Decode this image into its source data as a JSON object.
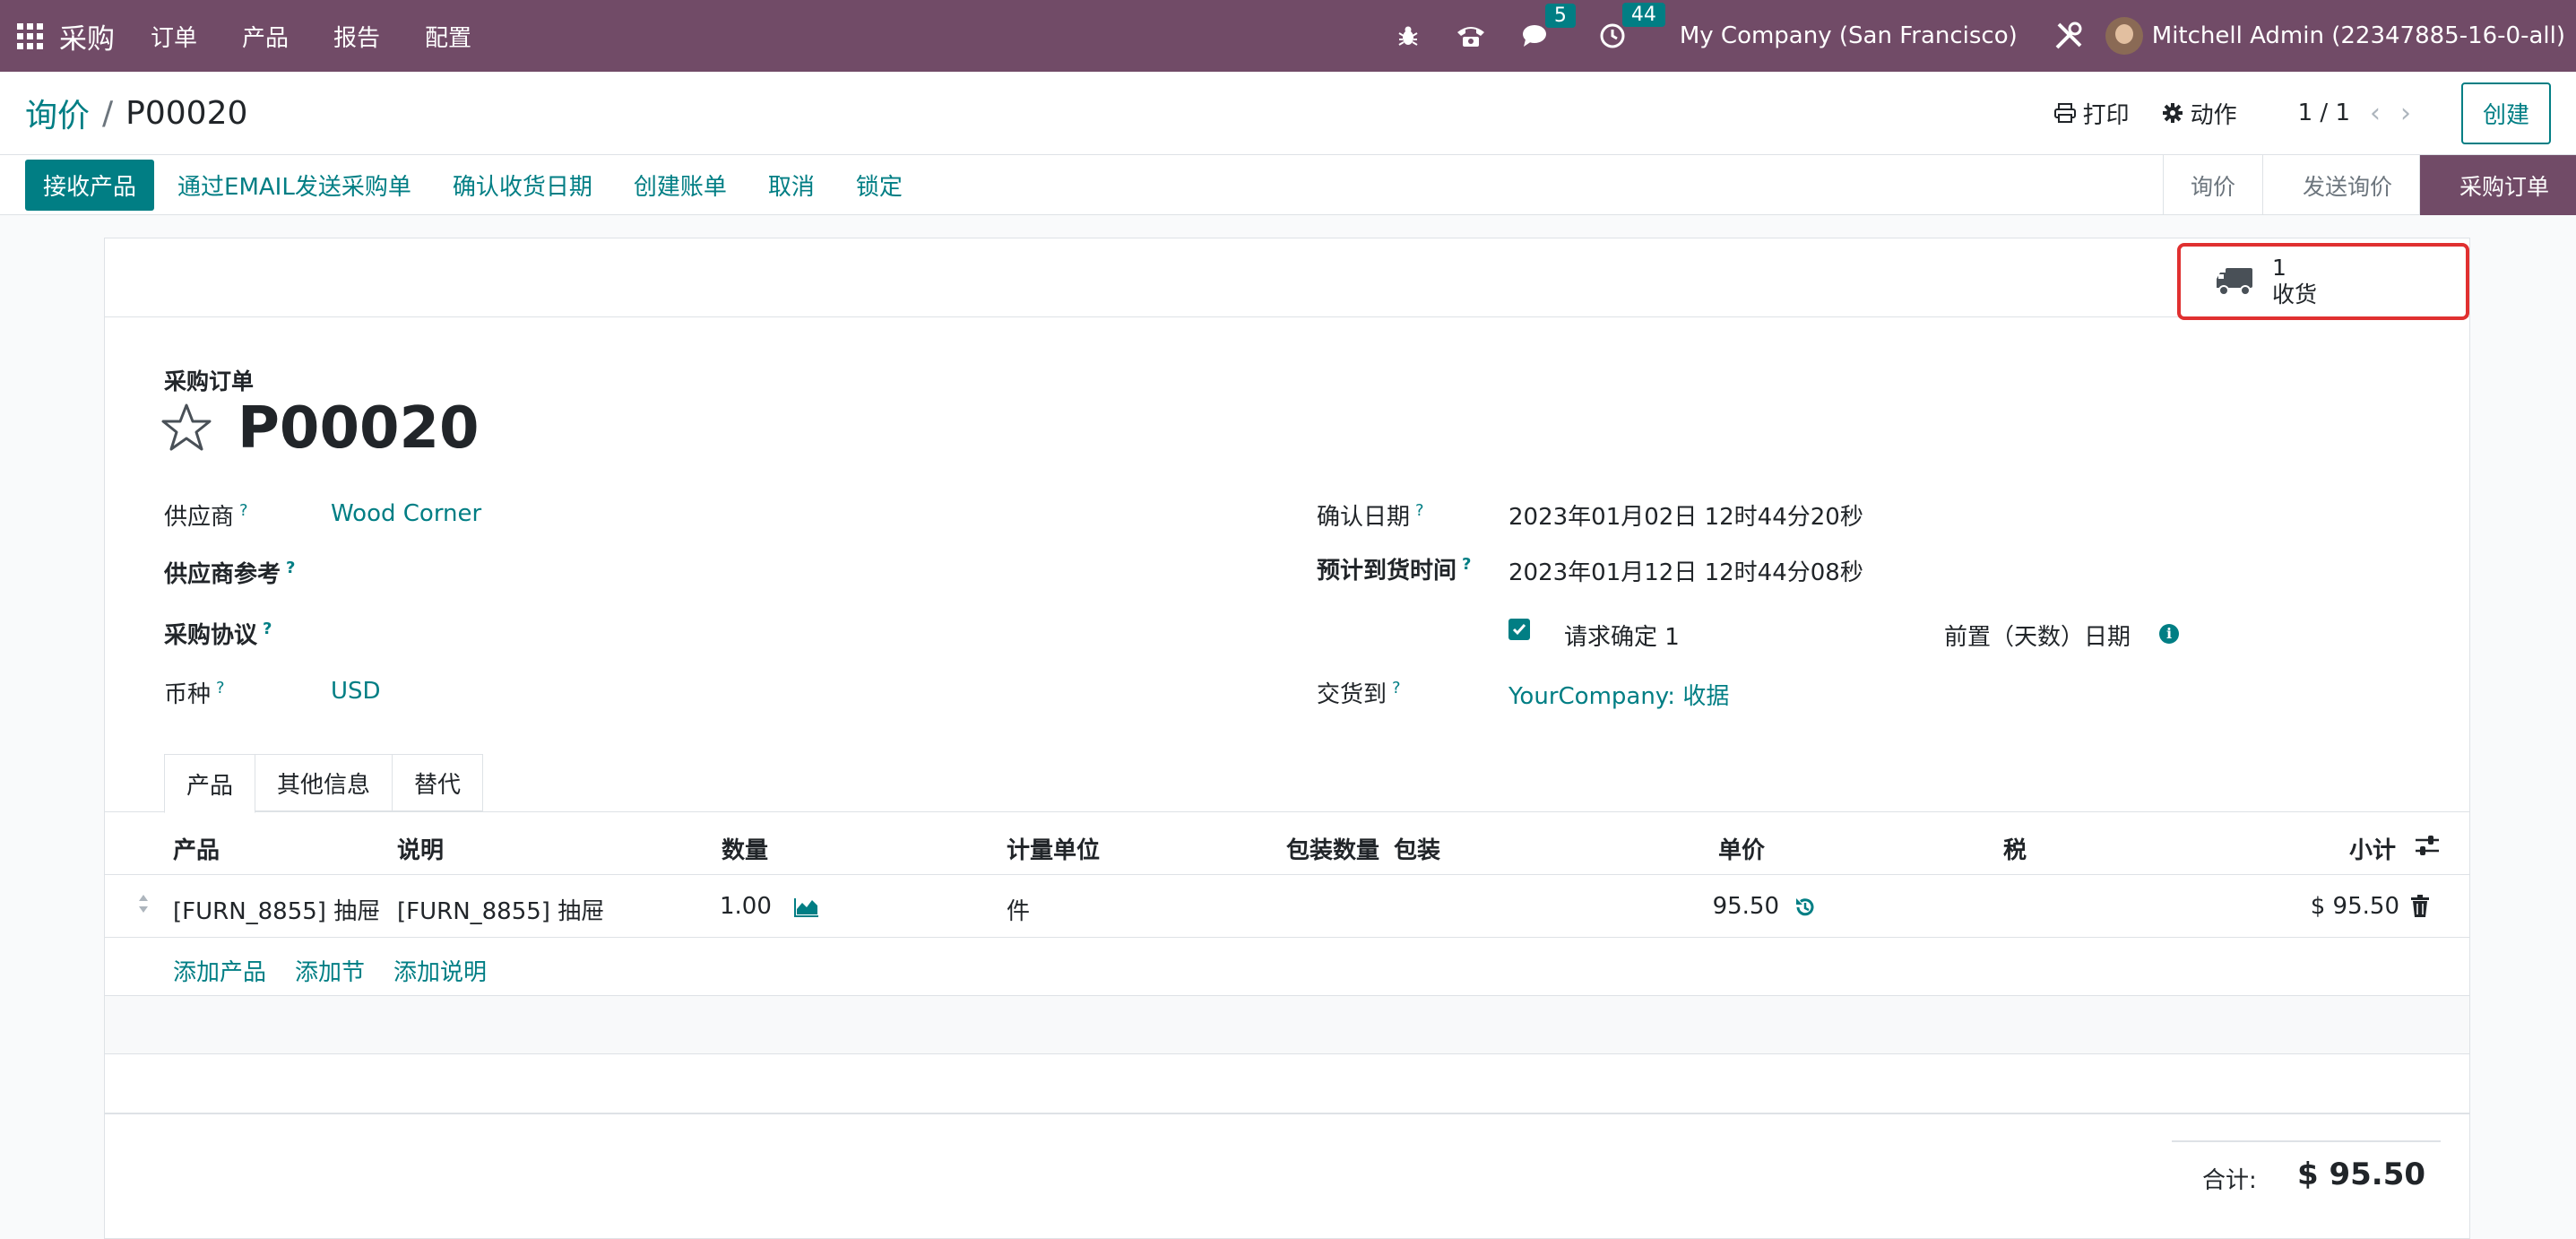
{
  "navbar": {
    "app_name": "采购",
    "menus": [
      "订单",
      "产品",
      "报告",
      "配置"
    ],
    "messages_count": "5",
    "activities_count": "44",
    "company": "My Company (San Francisco)",
    "user": "Mitchell Admin (22347885-16-0-all)"
  },
  "breadcrumb": {
    "parent": "询价",
    "separator": "/",
    "current": "P00020"
  },
  "control": {
    "print_label": "打印",
    "action_label": "动作",
    "pager": "1 / 1",
    "create_label": "创建"
  },
  "statusbar": {
    "buttons": [
      "接收产品",
      "通过EMAIL发送采购单",
      "确认收货日期",
      "创建账单",
      "取消",
      "锁定"
    ],
    "stages": [
      "询价",
      "发送询价",
      "采购订单"
    ],
    "active_stage": "采购订单"
  },
  "smart_button": {
    "count": "1",
    "label": "收货"
  },
  "form": {
    "title_label": "采购订单",
    "title": "P00020",
    "vendor_label": "供应商",
    "vendor": "Wood Corner",
    "vendor_ref_label": "供应商参考",
    "agreement_label": "采购协议",
    "currency_label": "币种",
    "currency": "USD",
    "confirm_date_label": "确认日期",
    "confirm_date": "2023年01月02日 12时44分20秒",
    "expected_arrival_label": "预计到货时间",
    "expected_arrival": "2023年01月12日 12时44分08秒",
    "ask_confirm": "请求确定 1",
    "lead_days_label": "前置（天数）日期",
    "deliver_to_label": "交货到",
    "deliver_to": "YourCompany: 收据",
    "help_mark": "?"
  },
  "tabs": [
    "产品",
    "其他信息",
    "替代"
  ],
  "table": {
    "headers": {
      "product": "产品",
      "description": "说明",
      "quantity": "数量",
      "uom": "计量单位",
      "pack_qty": "包装数量",
      "packaging": "包装",
      "unit_price": "单价",
      "tax": "税",
      "subtotal": "小计"
    },
    "rows": [
      {
        "product": "[FURN_8855] 抽屉",
        "description": "[FURN_8855] 抽屉",
        "quantity": "1.00",
        "uom": "件",
        "unit_price": "95.50",
        "subtotal": "$ 95.50"
      }
    ],
    "add_product": "添加产品",
    "add_section": "添加节",
    "add_note": "添加说明"
  },
  "totals": {
    "label": "合计:",
    "value": "$ 95.50"
  },
  "colors": {
    "brand": "#714b67",
    "accent": "#017e84",
    "highlight": "#e03030"
  }
}
